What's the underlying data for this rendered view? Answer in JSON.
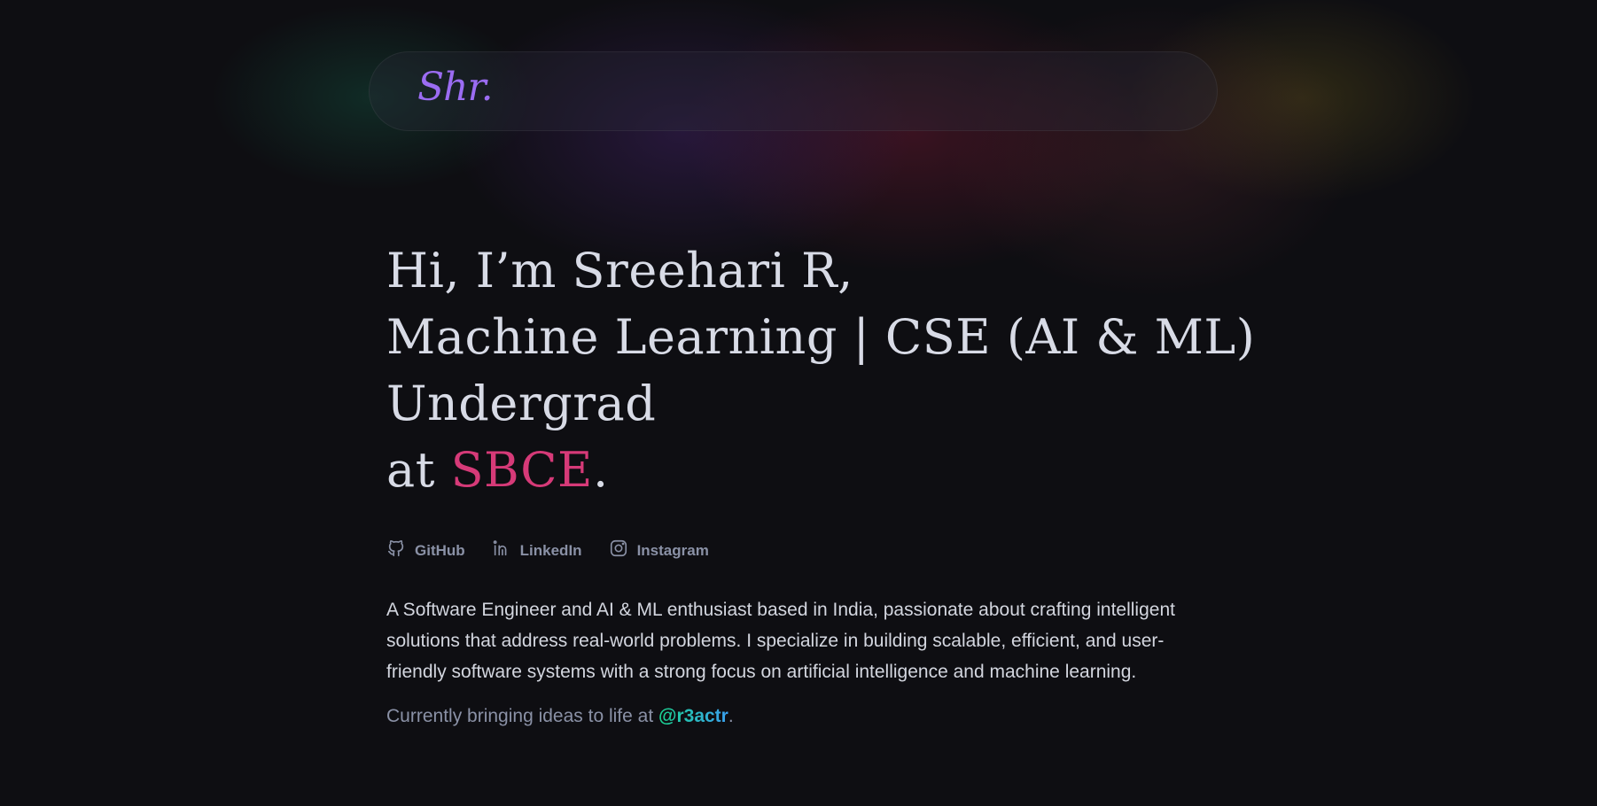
{
  "nav": {
    "logo": "Shr."
  },
  "hero": {
    "line1": "Hi, I’m Sreehari R,",
    "line2": "Machine Learning | CSE (AI & ML)",
    "line3": "Undergrad",
    "line4_prefix": "at ",
    "line4_highlight": "SBCE",
    "line4_suffix": "."
  },
  "socials": [
    {
      "label": "GitHub",
      "icon": "github-icon"
    },
    {
      "label": "LinkedIn",
      "icon": "linkedin-icon"
    },
    {
      "label": "Instagram",
      "icon": "instagram-icon"
    }
  ],
  "bio": "A Software Engineer and AI & ML enthusiast based in India, passionate about crafting intelligent solutions that address real-world problems. I specialize in building scalable, efficient, and user-friendly software systems with a strong focus on artificial intelligence and machine learning.",
  "current": {
    "prefix": "Currently bringing ideas to life at ",
    "link": "@r3actr",
    "suffix": "."
  },
  "colors": {
    "background": "#0e0e12",
    "logo": "#9b6cf2",
    "accent": "#d63a78",
    "link_start": "#19d48e",
    "link_end": "#3aa0f0",
    "muted": "#8a91a6"
  }
}
